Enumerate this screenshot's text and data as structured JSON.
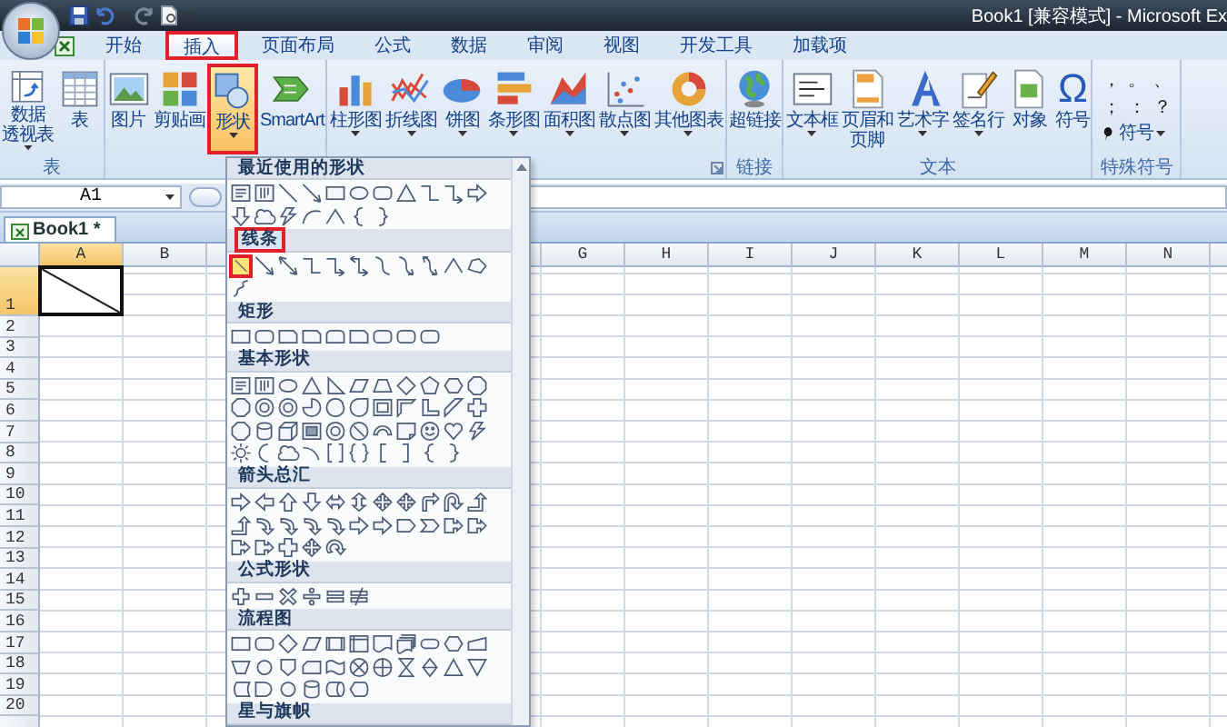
{
  "title_bar": {
    "title": "Book1 [兼容模式] - Microsoft Ex"
  },
  "tabs": [
    {
      "label": "开始",
      "selected": false,
      "highlighted": false
    },
    {
      "label": "插入",
      "selected": true,
      "highlighted": true
    },
    {
      "label": "页面布局",
      "selected": false,
      "highlighted": false
    },
    {
      "label": "公式",
      "selected": false,
      "highlighted": false
    },
    {
      "label": "数据",
      "selected": false,
      "highlighted": false
    },
    {
      "label": "审阅",
      "selected": false,
      "highlighted": false
    },
    {
      "label": "视图",
      "selected": false,
      "highlighted": false
    },
    {
      "label": "开发工具",
      "selected": false,
      "highlighted": false
    },
    {
      "label": "加载项",
      "selected": false,
      "highlighted": false
    }
  ],
  "ribbon": {
    "groups": [
      {
        "label": "表",
        "buttons": [
          {
            "label_lines": [
              "数据",
              "透视表"
            ],
            "menu": true,
            "pressed": false,
            "highlighted": false
          },
          {
            "label": "表",
            "menu": false,
            "pressed": false,
            "highlighted": false
          }
        ]
      },
      {
        "buttons": [
          {
            "label": "图片",
            "menu": false,
            "pressed": false,
            "highlighted": false
          },
          {
            "label": "剪贴画",
            "menu": false,
            "pressed": false,
            "highlighted": false
          },
          {
            "label": "形状",
            "menu": true,
            "pressed": true,
            "highlighted": true
          },
          {
            "label": "SmartArt",
            "menu": false,
            "pressed": false,
            "highlighted": false
          }
        ]
      },
      {
        "launcher": true,
        "buttons": [
          {
            "label": "柱形图",
            "menu": true,
            "pressed": false,
            "highlighted": false
          },
          {
            "label": "折线图",
            "menu": true,
            "pressed": false,
            "highlighted": false
          },
          {
            "label": "饼图",
            "menu": true,
            "pressed": false,
            "highlighted": false
          },
          {
            "label": "条形图",
            "menu": true,
            "pressed": false,
            "highlighted": false
          },
          {
            "label": "面积图",
            "menu": true,
            "pressed": false,
            "highlighted": false
          },
          {
            "label": "散点图",
            "menu": true,
            "pressed": false,
            "highlighted": false
          },
          {
            "label": "其他图表",
            "menu": true,
            "pressed": false,
            "highlighted": false
          }
        ]
      },
      {
        "label": "链接",
        "buttons": [
          {
            "label": "超链接",
            "menu": false,
            "pressed": false,
            "highlighted": false
          }
        ]
      },
      {
        "label": "文本",
        "buttons": [
          {
            "label": "文本框",
            "menu": true,
            "pressed": false,
            "highlighted": false
          },
          {
            "label_lines": [
              "页眉和",
              "页脚"
            ],
            "menu": false,
            "pressed": false,
            "highlighted": false
          },
          {
            "label": "艺术字",
            "menu": true,
            "pressed": false,
            "highlighted": false
          },
          {
            "label": "签名行",
            "menu": true,
            "pressed": false,
            "highlighted": false
          },
          {
            "label": "对象",
            "menu": false,
            "pressed": false,
            "highlighted": false
          },
          {
            "label": "符号",
            "glyph": "Ω",
            "menu": false,
            "pressed": false,
            "highlighted": false
          }
        ]
      },
      {
        "label": "特殊符号",
        "kind": "symbols",
        "symbols": [
          "，",
          "。",
          "、",
          "；",
          "：",
          "？"
        ],
        "symbol_button": {
          "label": "符号",
          "menu": true
        }
      }
    ]
  },
  "formula_bar": {
    "name_box": "A1"
  },
  "sheet_tabs": [
    {
      "label": "Book1 *",
      "selected": true
    }
  ],
  "sheet": {
    "columns_left": [
      {
        "label": "A",
        "selected": true
      },
      {
        "label": "B",
        "selected": false
      }
    ],
    "columns_right": [
      {
        "label": "G",
        "selected": false
      },
      {
        "label": "H",
        "selected": false
      },
      {
        "label": "I",
        "selected": false
      },
      {
        "label": "J",
        "selected": false
      },
      {
        "label": "K",
        "selected": false
      },
      {
        "label": "L",
        "selected": false
      },
      {
        "label": "M",
        "selected": false
      },
      {
        "label": "N",
        "selected": false
      }
    ],
    "rows": [
      {
        "label": "1",
        "selected": true
      },
      {
        "label": "2",
        "selected": false
      },
      {
        "label": "3",
        "selected": false
      },
      {
        "label": "4",
        "selected": false
      },
      {
        "label": "5",
        "selected": false
      },
      {
        "label": "6",
        "selected": false
      },
      {
        "label": "7",
        "selected": false
      },
      {
        "label": "8",
        "selected": false
      },
      {
        "label": "9",
        "selected": false
      },
      {
        "label": "10",
        "selected": false
      },
      {
        "label": "11",
        "selected": false
      },
      {
        "label": "12",
        "selected": false
      },
      {
        "label": "13",
        "selected": false
      },
      {
        "label": "14",
        "selected": false
      },
      {
        "label": "15",
        "selected": false
      },
      {
        "label": "16",
        "selected": false
      },
      {
        "label": "17",
        "selected": false
      },
      {
        "label": "18",
        "selected": false
      },
      {
        "label": "19",
        "selected": false
      },
      {
        "label": "20",
        "selected": false
      }
    ],
    "active_cell": {
      "diagonal": true
    }
  },
  "shapes_menu": {
    "sections": [
      {
        "title": "最近使用的形状",
        "highlighted": false,
        "shapes": [
          {
            "kind": "text-box"
          },
          {
            "kind": "vertical-text-box"
          },
          {
            "kind": "line"
          },
          {
            "kind": "arrow-line"
          },
          {
            "kind": "rect"
          },
          {
            "kind": "oval"
          },
          {
            "kind": "rounded-rect"
          },
          {
            "kind": "triangle"
          },
          {
            "kind": "elbow-connector"
          },
          {
            "kind": "elbow-arrow"
          },
          {
            "kind": "right-arrow"
          },
          {
            "kind": "down-arrow"
          },
          {
            "kind": "cloud"
          },
          {
            "kind": "lightning"
          },
          {
            "kind": "curve"
          },
          {
            "kind": "peak"
          },
          {
            "kind": "left-brace"
          },
          {
            "kind": "right-brace"
          }
        ]
      },
      {
        "title": "线条",
        "highlighted": true,
        "shapes": [
          {
            "kind": "line",
            "selected": true
          },
          {
            "kind": "arrow-line",
            "selected": false
          },
          {
            "kind": "double-arrow-line",
            "selected": false
          },
          {
            "kind": "elbow-connector",
            "selected": false
          },
          {
            "kind": "elbow-arrow",
            "selected": false
          },
          {
            "kind": "elbow-double-arrow",
            "selected": false
          },
          {
            "kind": "curve-connector",
            "selected": false
          },
          {
            "kind": "curve-arrow",
            "selected": false
          },
          {
            "kind": "curve-double-arrow",
            "selected": false
          },
          {
            "kind": "peak",
            "selected": false
          },
          {
            "kind": "freeform",
            "selected": false
          },
          {
            "kind": "scribble",
            "selected": false
          }
        ]
      },
      {
        "title": "矩形",
        "highlighted": false,
        "shapes": [
          {
            "kind": "rect"
          },
          {
            "kind": "rounded-rect"
          },
          {
            "kind": "snip-rect"
          },
          {
            "kind": "snip-rect"
          },
          {
            "kind": "round-top-rect"
          },
          {
            "kind": "snip-rect"
          },
          {
            "kind": "rounded-rect"
          },
          {
            "kind": "rounded-rect"
          },
          {
            "kind": "rounded-rect"
          }
        ]
      },
      {
        "title": "基本形状",
        "highlighted": false,
        "shapes": [
          {
            "kind": "text-box"
          },
          {
            "kind": "vertical-text-box"
          },
          {
            "kind": "oval"
          },
          {
            "kind": "triangle"
          },
          {
            "kind": "right-triangle"
          },
          {
            "kind": "parallelogram"
          },
          {
            "kind": "trapezoid"
          },
          {
            "kind": "diamond"
          },
          {
            "kind": "pentagon"
          },
          {
            "kind": "hexagon"
          },
          {
            "kind": "octagon"
          },
          {
            "kind": "octagon"
          },
          {
            "kind": "donut"
          },
          {
            "kind": "donut"
          },
          {
            "kind": "pie"
          },
          {
            "kind": "chord"
          },
          {
            "kind": "teardrop"
          },
          {
            "kind": "frame"
          },
          {
            "kind": "half-frame"
          },
          {
            "kind": "l-shape"
          },
          {
            "kind": "diagonal-stripe"
          },
          {
            "kind": "cross"
          },
          {
            "kind": "octagon"
          },
          {
            "kind": "can"
          },
          {
            "kind": "cube"
          },
          {
            "kind": "bevel"
          },
          {
            "kind": "donut"
          },
          {
            "kind": "no-symbol"
          },
          {
            "kind": "block-arc"
          },
          {
            "kind": "folded-corner"
          },
          {
            "kind": "smiley"
          },
          {
            "kind": "heart"
          },
          {
            "kind": "lightning"
          },
          {
            "kind": "sun"
          },
          {
            "kind": "moon"
          },
          {
            "kind": "cloud"
          },
          {
            "kind": "arc"
          },
          {
            "kind": "bracket-pair"
          },
          {
            "kind": "brace-pair"
          },
          {
            "kind": "left-bracket"
          },
          {
            "kind": "right-bracket"
          },
          {
            "kind": "left-brace"
          },
          {
            "kind": "right-brace"
          }
        ]
      },
      {
        "title": "箭头总汇",
        "highlighted": false,
        "shapes": [
          {
            "kind": "right-arrow"
          },
          {
            "kind": "left-arrow"
          },
          {
            "kind": "up-arrow"
          },
          {
            "kind": "down-arrow"
          },
          {
            "kind": "left-right-arrow"
          },
          {
            "kind": "up-down-arrow"
          },
          {
            "kind": "quad-arrow"
          },
          {
            "kind": "quad-arrow"
          },
          {
            "kind": "bent-arrow"
          },
          {
            "kind": "u-turn-arrow"
          },
          {
            "kind": "corner-arrow"
          },
          {
            "kind": "corner-arrow"
          },
          {
            "kind": "curved-arrow"
          },
          {
            "kind": "curved-arrow"
          },
          {
            "kind": "curved-arrow"
          },
          {
            "kind": "curved-arrow"
          },
          {
            "kind": "right-arrow"
          },
          {
            "kind": "right-arrow"
          },
          {
            "kind": "home-plate"
          },
          {
            "kind": "chevron"
          },
          {
            "kind": "callout-arrow"
          },
          {
            "kind": "callout-arrow"
          },
          {
            "kind": "callout-arrow"
          },
          {
            "kind": "callout-arrow"
          },
          {
            "kind": "cross"
          },
          {
            "kind": "quad-arrow"
          },
          {
            "kind": "circular-arrow"
          }
        ]
      },
      {
        "title": "公式形状",
        "highlighted": false,
        "shapes": [
          {
            "kind": "plus"
          },
          {
            "kind": "minus"
          },
          {
            "kind": "multiply"
          },
          {
            "kind": "divide"
          },
          {
            "kind": "equal"
          },
          {
            "kind": "not-equal"
          }
        ]
      },
      {
        "title": "流程图",
        "highlighted": false,
        "shapes": [
          {
            "kind": "rect"
          },
          {
            "kind": "rounded-rect"
          },
          {
            "kind": "diamond"
          },
          {
            "kind": "parallelogram"
          },
          {
            "kind": "predefined-process"
          },
          {
            "kind": "internal-storage"
          },
          {
            "kind": "document"
          },
          {
            "kind": "multi-document"
          },
          {
            "kind": "terminator"
          },
          {
            "kind": "hexagon"
          },
          {
            "kind": "manual-input"
          },
          {
            "kind": "manual-operation"
          },
          {
            "kind": "circle"
          },
          {
            "kind": "offpage-connector"
          },
          {
            "kind": "card"
          },
          {
            "kind": "punched-tape"
          },
          {
            "kind": "summing-junction"
          },
          {
            "kind": "or-circle"
          },
          {
            "kind": "collate"
          },
          {
            "kind": "sort"
          },
          {
            "kind": "triangle"
          },
          {
            "kind": "inverted-triangle"
          },
          {
            "kind": "stored-data"
          },
          {
            "kind": "delay"
          },
          {
            "kind": "circle"
          },
          {
            "kind": "can"
          },
          {
            "kind": "direct-access"
          },
          {
            "kind": "display"
          }
        ]
      },
      {
        "title": "星与旗帜",
        "highlighted": false
      }
    ]
  }
}
